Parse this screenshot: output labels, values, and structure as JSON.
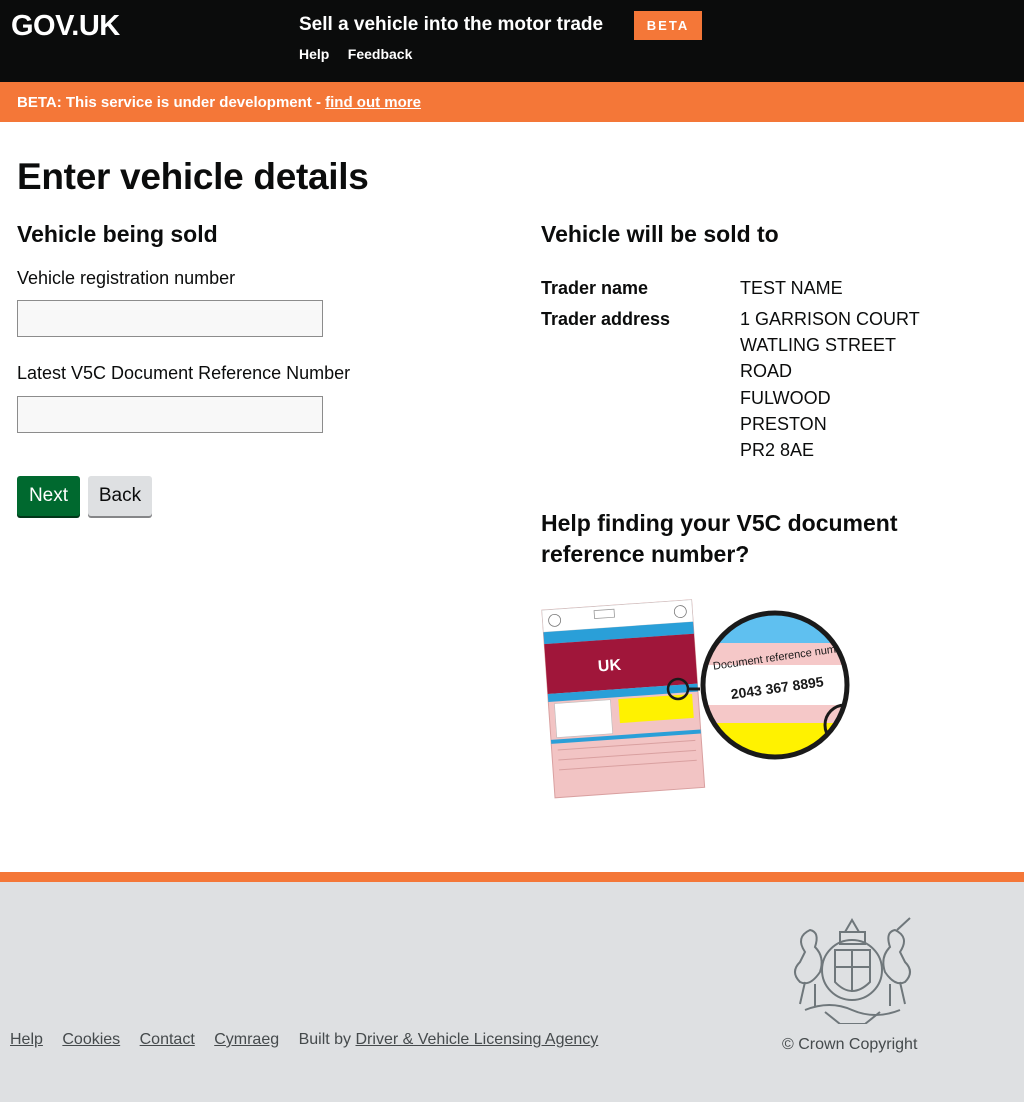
{
  "header": {
    "logo": "GOV.UK",
    "service_name": "Sell a vehicle into the motor trade",
    "phase_badge": "BETA",
    "nav": [
      "Help",
      "Feedback"
    ]
  },
  "beta_banner": {
    "text": "BETA: This service is under development - ",
    "link": "find out more"
  },
  "main": {
    "title": "Enter vehicle details",
    "vehicle_section": {
      "heading": "Vehicle being sold",
      "registration_label": "Vehicle registration number",
      "registration_value": "",
      "doc_ref_label": "Latest V5C Document Reference Number",
      "doc_ref_value": ""
    },
    "buttons": {
      "next": "Next",
      "back": "Back"
    },
    "trader_section": {
      "heading": "Vehicle will be sold to",
      "name_key": "Trader name",
      "name_value": "TEST NAME",
      "address_key": "Trader address",
      "address_lines": [
        "1 GARRISON COURT",
        "WATLING STREET",
        "ROAD",
        "FULWOOD",
        "PRESTON",
        "PR2 8AE"
      ]
    },
    "help": {
      "heading": "Help finding your V5C document reference number?",
      "illustration": {
        "magnifier_label": "Document reference number",
        "magnifier_number": "2043 367 8895",
        "doc_text": "UK"
      }
    }
  },
  "footer": {
    "links": [
      "Help",
      "Cookies",
      "Contact",
      "Cymraeg"
    ],
    "built_by_prefix": "Built by ",
    "built_by_link": "Driver & Vehicle Licensing Agency",
    "copyright": "© Crown Copyright"
  },
  "colors": {
    "header_bg": "#0b0c0c",
    "beta_orange": "#f47738",
    "next_button": "#00692f",
    "footer_bg": "#dee0e2"
  }
}
